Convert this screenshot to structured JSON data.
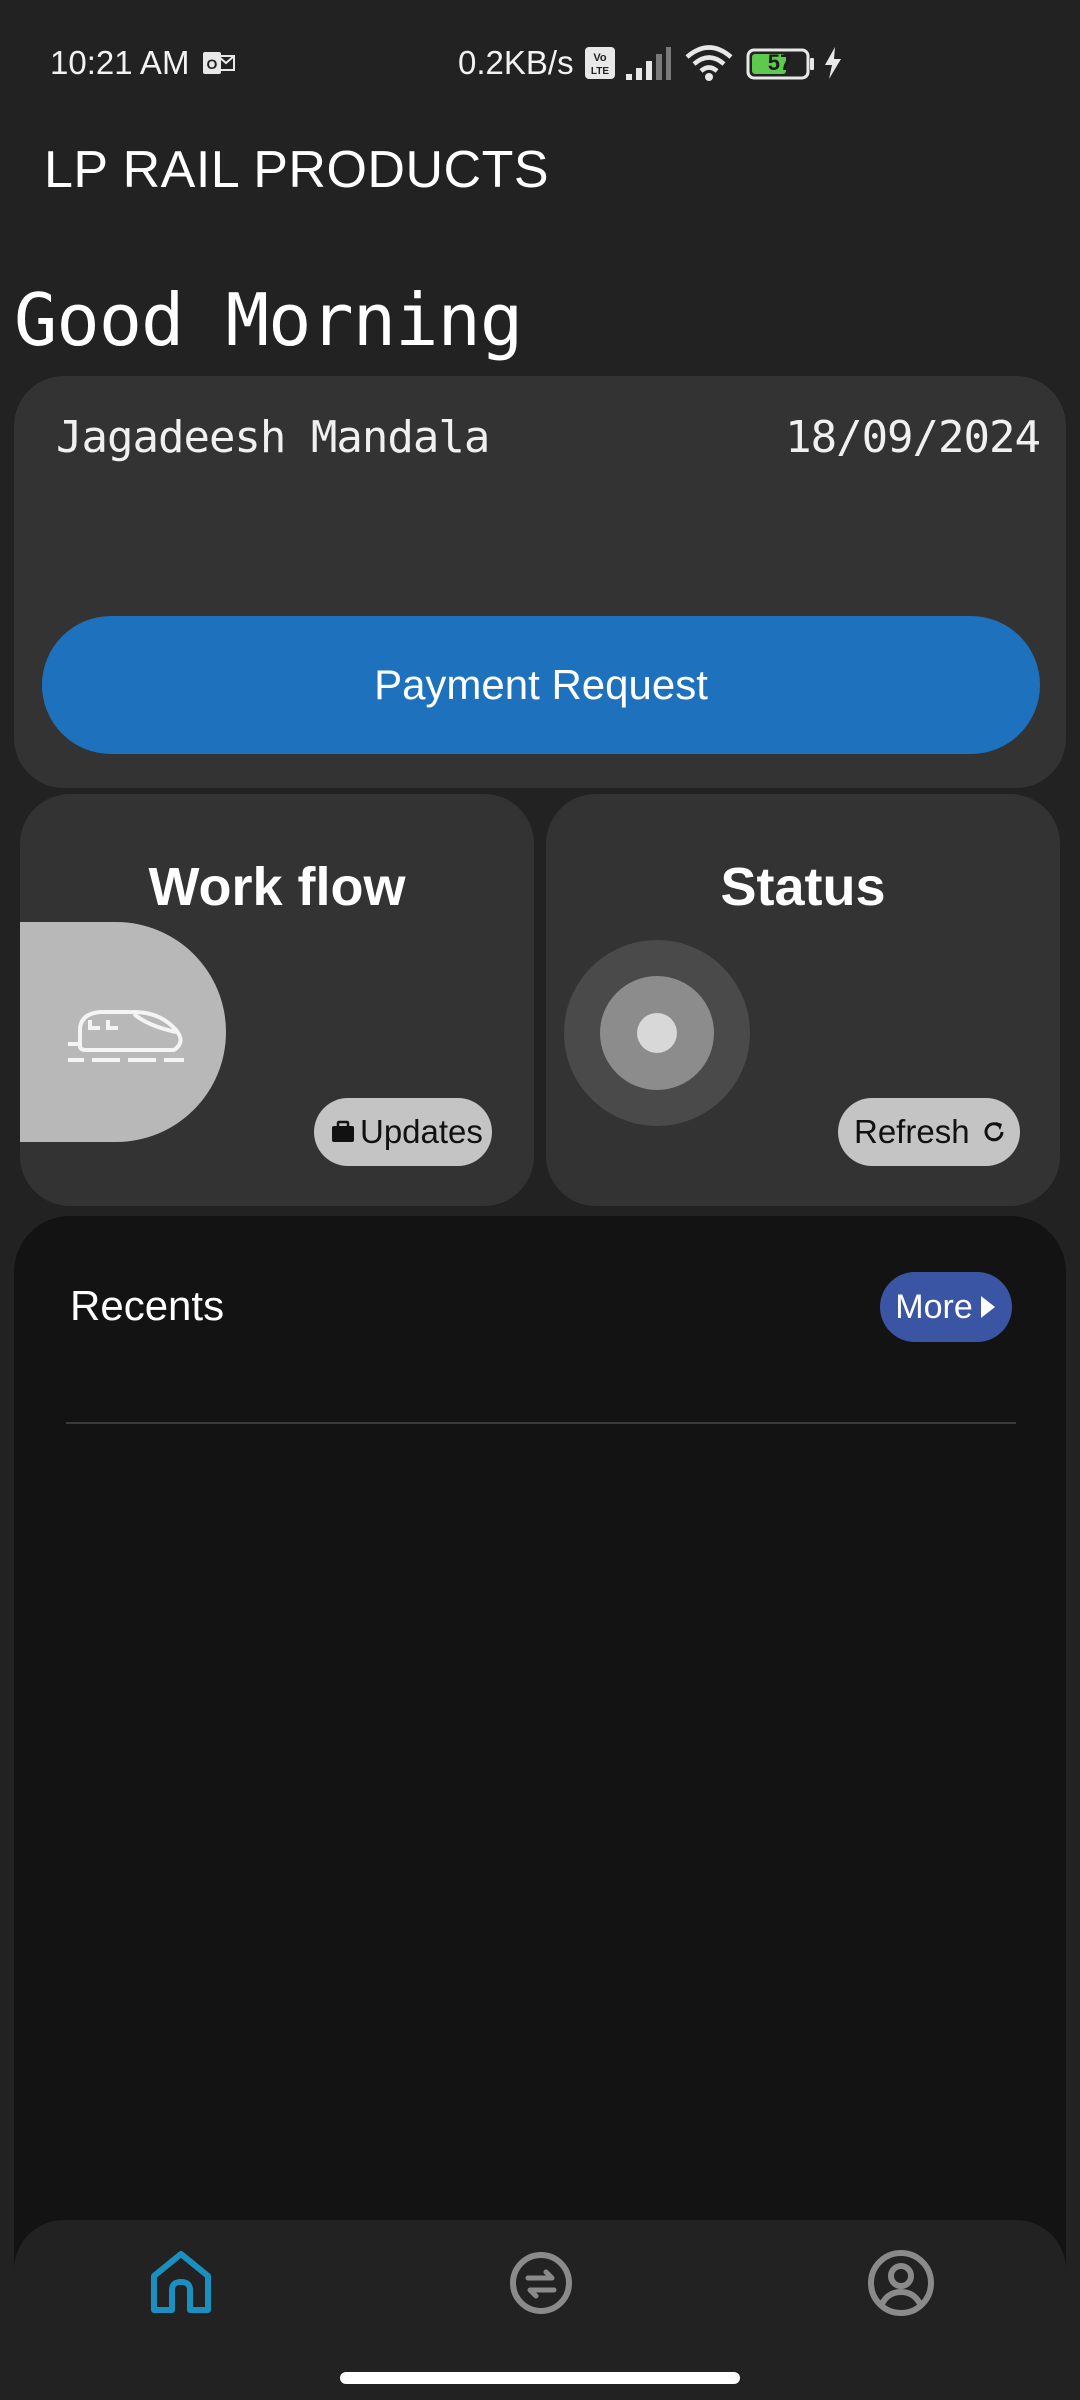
{
  "status_bar": {
    "time": "10:21 AM",
    "net_speed": "0.2KB/s",
    "battery": "57",
    "icons": [
      "outlook-notification-icon",
      "volte-icon",
      "signal-icon",
      "wifi-icon",
      "battery-icon",
      "charging-icon"
    ]
  },
  "header": {
    "title": "LP RAIL PRODUCTS",
    "greeting": "Good Morning"
  },
  "user_card": {
    "name": "Jagadeesh Mandala",
    "date": "18/09/2024",
    "payment_button": "Payment Request"
  },
  "workflow_card": {
    "title": "Work flow",
    "chip_label": "Updates",
    "icon": "train-icon",
    "chip_icon": "briefcase-icon"
  },
  "status_card": {
    "title": "Status",
    "chip_label": "Refresh",
    "icon": "target-indicator-icon",
    "chip_icon": "refresh-icon"
  },
  "recents": {
    "title": "Recents",
    "more_button": "More"
  },
  "bottom_nav": {
    "items": [
      "home-icon",
      "exchange-icon",
      "profile-icon"
    ],
    "active": "home-icon"
  },
  "colors": {
    "background": "#222222",
    "card": "#333333",
    "primary": "#1e72bd",
    "more_button": "#3a55a4",
    "active_nav": "#1a8fc0",
    "inactive_nav": "#8a8a8a"
  }
}
